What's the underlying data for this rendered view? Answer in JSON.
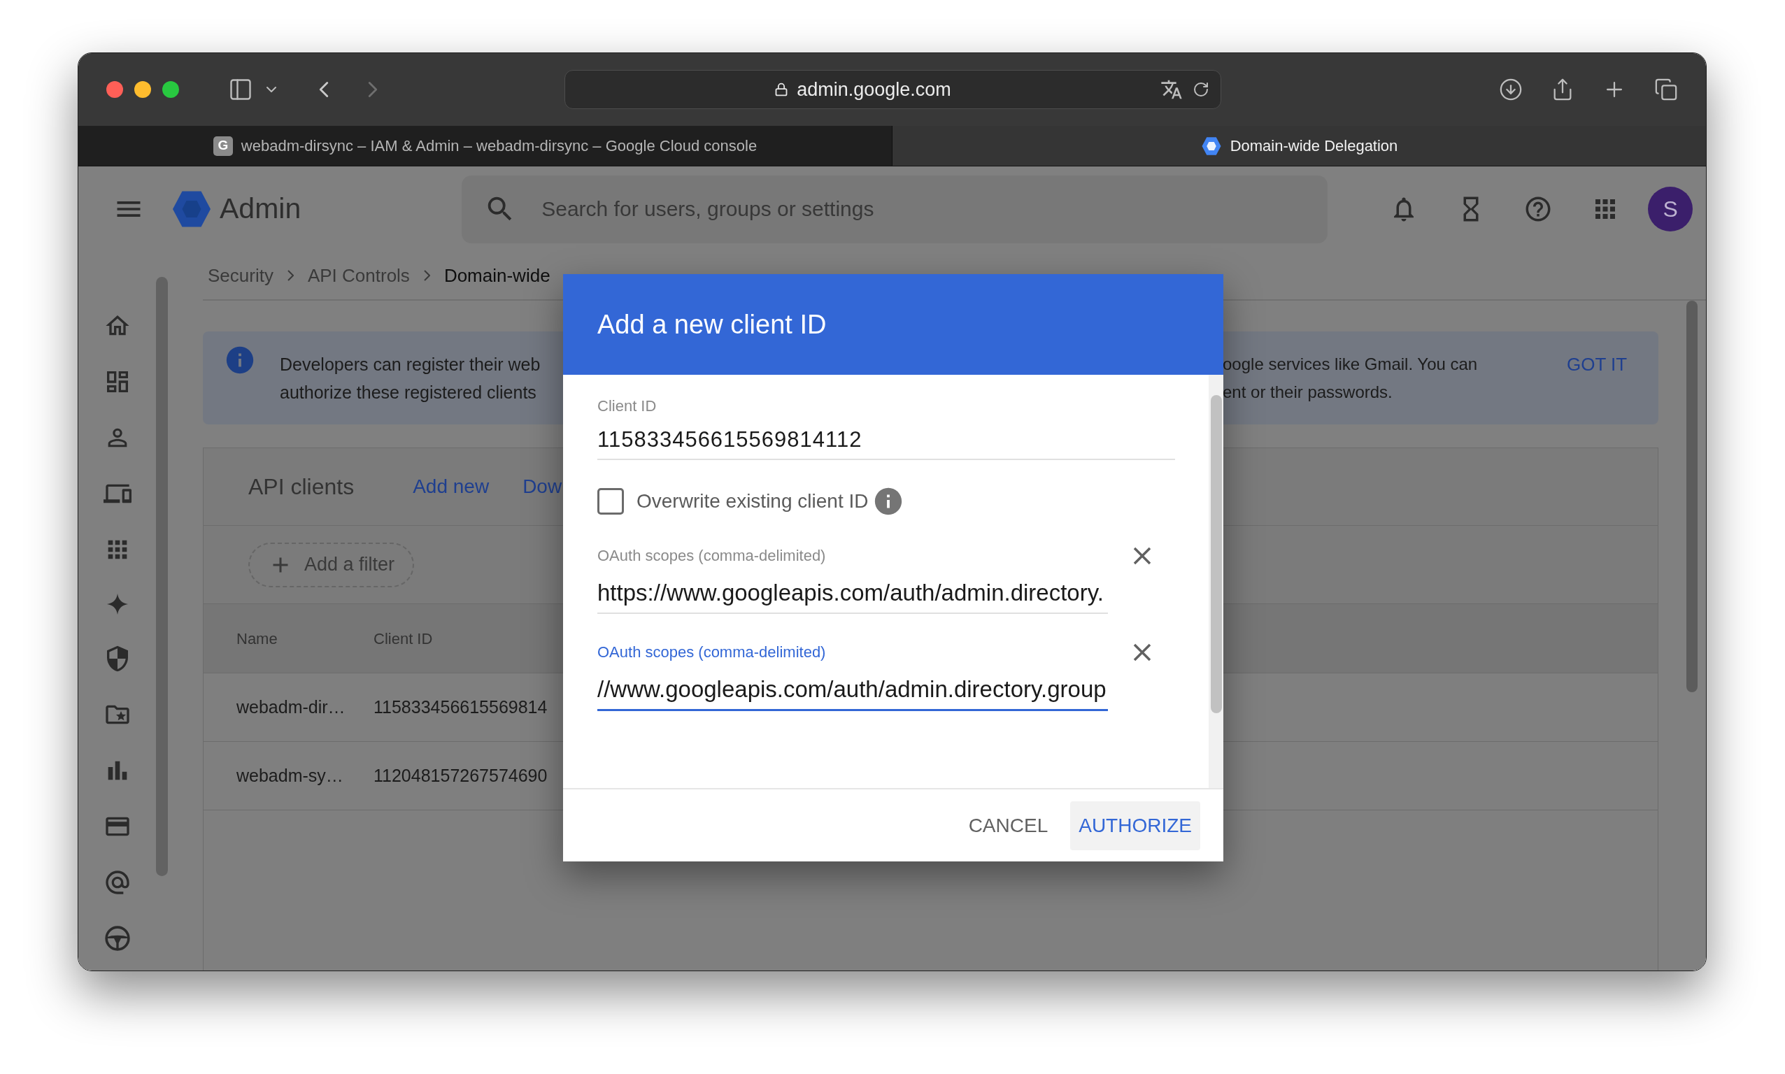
{
  "browser": {
    "url": "admin.google.com",
    "tabs": [
      {
        "favicon": "G",
        "title": "webadm-dirsync – IAM & Admin – webadm-dirsync – Google Cloud console",
        "selected": false
      },
      {
        "title": "Domain-wide Delegation",
        "selected": true
      }
    ]
  },
  "header": {
    "product": "Admin",
    "search": {
      "placeholder": "Search for users, groups or settings"
    },
    "avatar": "S"
  },
  "breadcrumb": [
    "Security",
    "API Controls",
    "Domain-wide"
  ],
  "banner": {
    "text_left": [
      "Developers can register their web",
      "authorize these registered clients"
    ],
    "text_right": [
      "oogle services like Gmail. You can",
      "ent or their passwords."
    ],
    "action": "GOT IT"
  },
  "api_clients": {
    "title": "API clients",
    "actions": [
      "Add new",
      "Dow"
    ],
    "filter": "Add a filter",
    "table": {
      "columns": [
        "Name",
        "Client ID"
      ],
      "rows": [
        [
          "webadm-dir…",
          "115833456615569814"
        ],
        [
          "webadm-sy…",
          "112048157267574690"
        ]
      ]
    }
  },
  "dialog": {
    "title": "Add a new client ID",
    "client_id": {
      "label": "Client ID",
      "value": "115833456615569814112"
    },
    "overwrite": {
      "label": "Overwrite existing client ID",
      "checked": false
    },
    "scopes": [
      {
        "label": "OAuth scopes (comma-delimited)",
        "value": "https://www.googleapis.com/auth/admin.directory.",
        "focused": false
      },
      {
        "label": "OAuth scopes (comma-delimited)",
        "value": "//www.googleapis.com/auth/admin.directory.group",
        "focused": true
      }
    ],
    "buttons": [
      {
        "label": "CANCEL",
        "kind": "text"
      },
      {
        "label": "AUTHORIZE",
        "kind": "primary"
      }
    ]
  }
}
